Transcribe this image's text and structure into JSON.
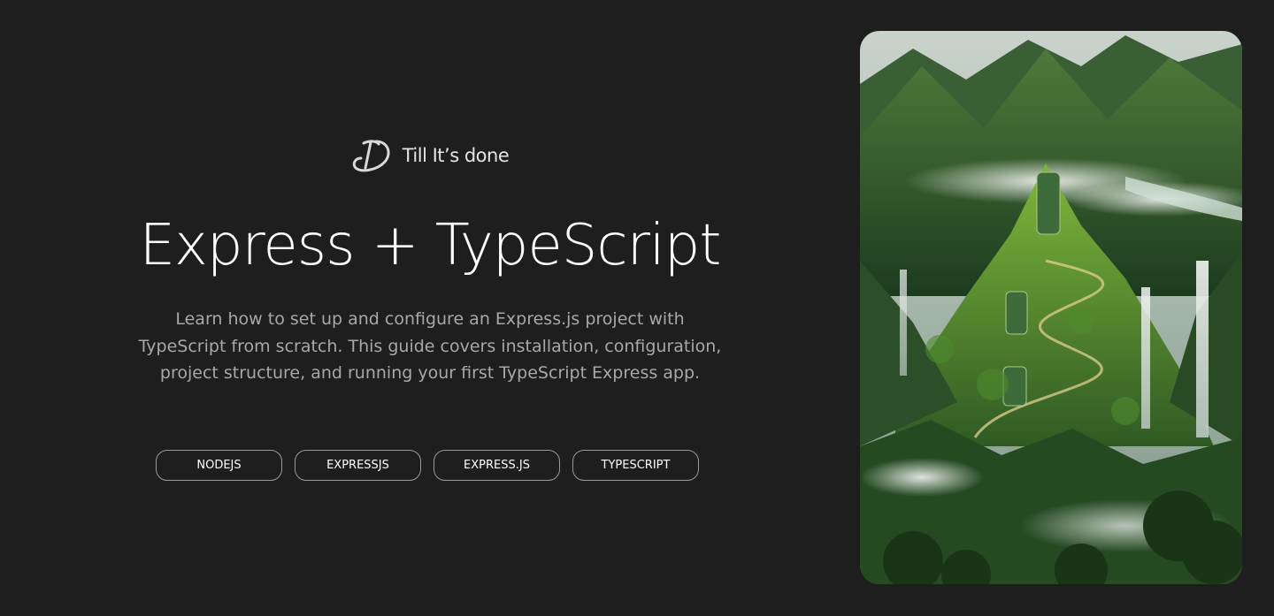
{
  "brand": {
    "name": "Till It’s done",
    "logo_icon": "td-monogram-icon"
  },
  "hero": {
    "title": "Express + TypeScript",
    "description": "Learn how to set up and configure an Express.js project with TypeScript from scratch. This guide covers installation, configuration, project structure, and running your first TypeScript Express app.",
    "tags": [
      "NODEJS",
      "EXPRESSJS",
      "EXPRESS.JS",
      "TYPESCRIPT"
    ]
  },
  "cover_image": {
    "subject": "mountain-waterfall-landscape-image"
  },
  "colors": {
    "background": "#1e1e1e",
    "title": "#ffffff",
    "description": "#a8a8a8",
    "tag_border": "#9a9a9a"
  }
}
